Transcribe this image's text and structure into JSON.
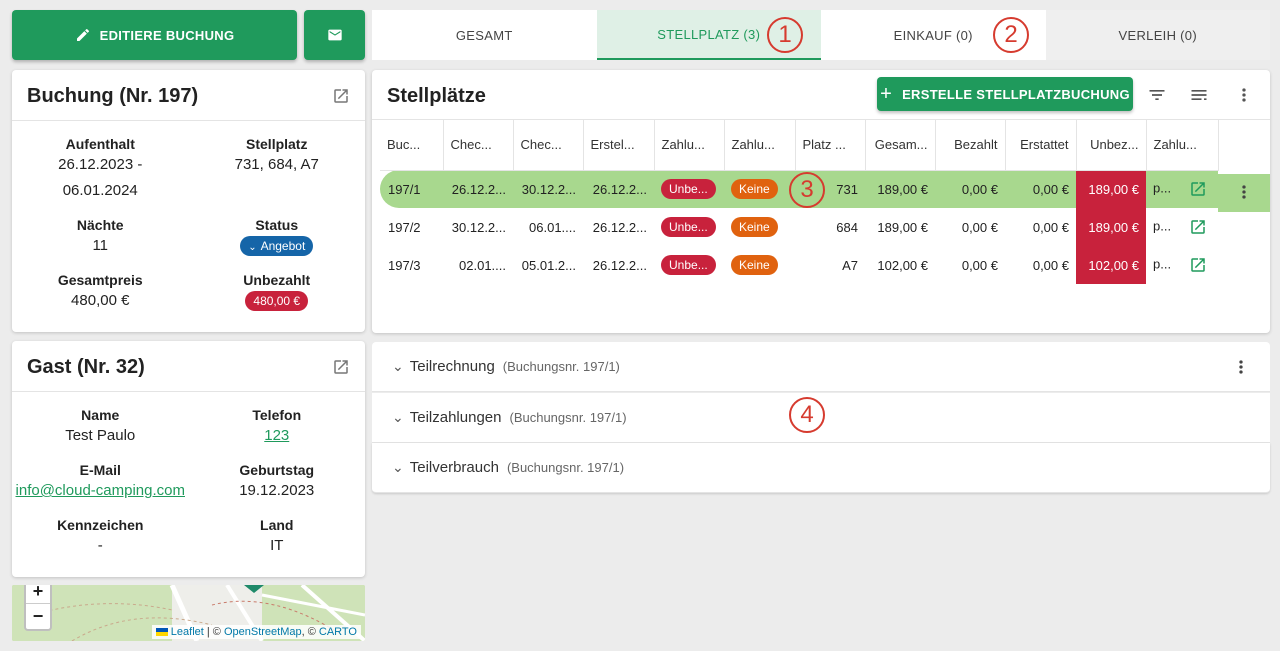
{
  "toolbar": {
    "edit_booking_label": "EDITIERE BUCHUNG"
  },
  "tabs": [
    {
      "label": "GESAMT"
    },
    {
      "label": "STELLPLATZ (3)"
    },
    {
      "label": "EINKAUF (0)"
    },
    {
      "label": "VERLEIH (0)"
    }
  ],
  "markers": [
    "1",
    "2",
    "3",
    "4"
  ],
  "booking": {
    "title": "Buchung (Nr. 197)",
    "stay_label": "Aufenthalt",
    "stay_value_1": "26.12.2023 -",
    "stay_value_2": "06.01.2024",
    "pitch_label": "Stellplatz",
    "pitch_value": "731, 684, A7",
    "nights_label": "Nächte",
    "nights_value": "11",
    "status_label": "Status",
    "status_value": "Angebot",
    "total_label": "Gesamtpreis",
    "total_value": "480,00 €",
    "unpaid_label": "Unbezahlt",
    "unpaid_value": "480,00 €"
  },
  "guest": {
    "title": "Gast (Nr. 32)",
    "name_label": "Name",
    "name_value": "Test Paulo",
    "phone_label": "Telefon",
    "phone_value": "123",
    "email_label": "E-Mail",
    "email_value": "info@cloud-camping.com",
    "birthday_label": "Geburtstag",
    "birthday_value": "19.12.2023",
    "plate_label": "Kennzeichen",
    "plate_value": "-",
    "country_label": "Land",
    "country_value": "IT"
  },
  "map": {
    "zoom_in": "+",
    "zoom_out": "−",
    "leaflet": "Leaflet",
    "sep1": " | © ",
    "osm": "OpenStreetMap",
    "sep2": ", © ",
    "carto": "CARTO"
  },
  "pitches": {
    "title": "Stellplätze",
    "create_label": "ERSTELLE STELLPLATZBUCHUNG",
    "columns": [
      "Buc...",
      "Chec...",
      "Chec...",
      "Erstel...",
      "Zahlu...",
      "Zahlu...",
      "Platz ...",
      "Gesam...",
      "Bezahlt",
      "Erstattet",
      "Unbez...",
      "Zahlu..."
    ],
    "rows": [
      {
        "id": "197/1",
        "checkin": "26.12.2...",
        "checkout": "30.12.2...",
        "created": "26.12.2...",
        "pay_status": "Unbe...",
        "pay_method": "Keine",
        "pitch": "731",
        "total": "189,00 €",
        "paid": "0,00 €",
        "refunded": "0,00 €",
        "unpaid": "189,00 €",
        "pay_more": "p..."
      },
      {
        "id": "197/2",
        "checkin": "30.12.2...",
        "checkout": "06.01....",
        "created": "26.12.2...",
        "pay_status": "Unbe...",
        "pay_method": "Keine",
        "pitch": "684",
        "total": "189,00 €",
        "paid": "0,00 €",
        "refunded": "0,00 €",
        "unpaid": "189,00 €",
        "pay_more": "p..."
      },
      {
        "id": "197/3",
        "checkin": "02.01....",
        "checkout": "05.01.2...",
        "created": "26.12.2...",
        "pay_status": "Unbe...",
        "pay_method": "Keine",
        "pitch": "A7",
        "total": "102,00 €",
        "paid": "0,00 €",
        "refunded": "0,00 €",
        "unpaid": "102,00 €",
        "pay_more": "p..."
      }
    ]
  },
  "accordions": [
    {
      "title": "Teilrechnung",
      "sub": "(Buchungsnr. 197/1)"
    },
    {
      "title": "Teilzahlungen",
      "sub": "(Buchungsnr. 197/1)"
    },
    {
      "title": "Teilverbrauch",
      "sub": "(Buchungsnr. 197/1)"
    }
  ],
  "colors": {
    "accent": "#1f9a5c",
    "selected_row": "#a8d88e",
    "unpaid": "#c8223c",
    "badge_orange": "#e0620f",
    "badge_blue": "#1565a8",
    "marker": "#d63b2f"
  }
}
